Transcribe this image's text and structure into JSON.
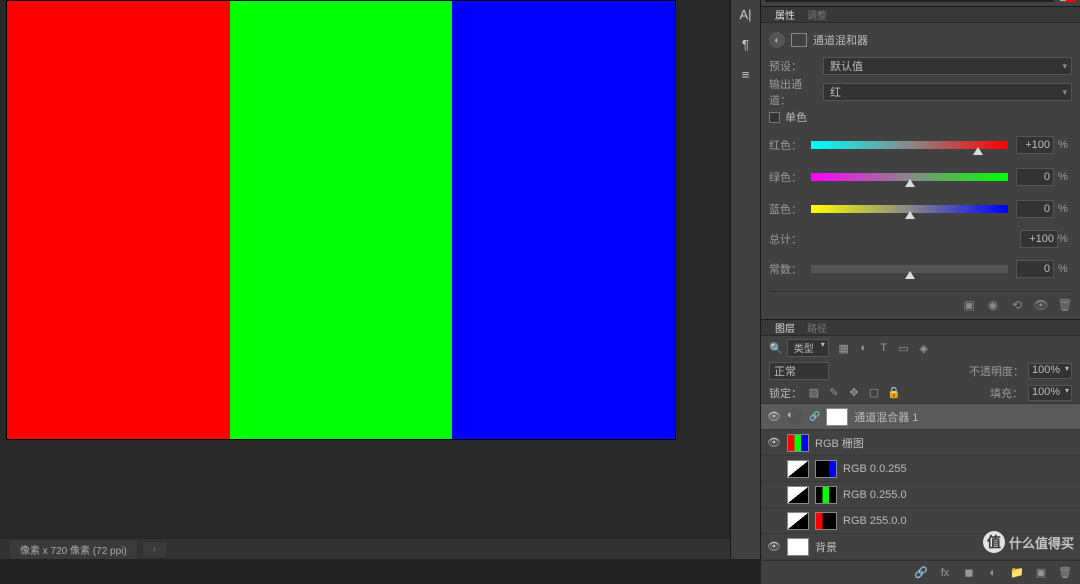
{
  "document": {
    "tab_label": "像素 x 720 像素 (72 ppi)"
  },
  "canvas": {
    "stripes": [
      "#ff0000",
      "#00ff00",
      "#0000ff"
    ]
  },
  "panels": {
    "properties": {
      "tab_label": "属性",
      "tab_label2": "调整",
      "adjustment_title": "通道混和器",
      "preset_label": "预设：",
      "preset_value": "默认值",
      "output_label": "输出通道：",
      "output_value": "红",
      "monochrome_label": "单色",
      "sliders": {
        "red": {
          "label": "红色：",
          "value": "+100",
          "unit": "%",
          "pos": 85
        },
        "green": {
          "label": "绿色：",
          "value": "0",
          "unit": "%",
          "pos": 50
        },
        "blue": {
          "label": "蓝色：",
          "value": "0",
          "unit": "%",
          "pos": 50
        }
      },
      "total": {
        "label": "总计：",
        "value": "+100",
        "unit": "%"
      },
      "constant": {
        "label": "常数：",
        "value": "0",
        "unit": "%",
        "pos": 50
      }
    },
    "layers": {
      "tab_label": "图层",
      "tab_label2": "路径",
      "kind_label": "类型",
      "blend_mode": "正常",
      "opacity_label": "不透明度：",
      "opacity_value": "100%",
      "lock_label": "锁定：",
      "fill_label": "填充：",
      "fill_value": "100%",
      "items": [
        {
          "name": "通道混合器 1",
          "thumb": "adj",
          "mask": "white",
          "visible": true,
          "selected": true,
          "linked": true
        },
        {
          "name": "RGB 栅图",
          "thumb": "rgb",
          "visible": true
        },
        {
          "name": "RGB 0.0.255",
          "thumb": "blue",
          "mask": "bw",
          "visible": false
        },
        {
          "name": "RGB 0.255.0",
          "thumb": "green",
          "mask": "bw",
          "visible": false
        },
        {
          "name": "RGB 255.0.0",
          "thumb": "red",
          "mask": "bw",
          "visible": false
        },
        {
          "name": "背景",
          "thumb": "white",
          "visible": true
        }
      ]
    }
  },
  "watermark": {
    "badge": "值",
    "text": "什么值得买"
  }
}
